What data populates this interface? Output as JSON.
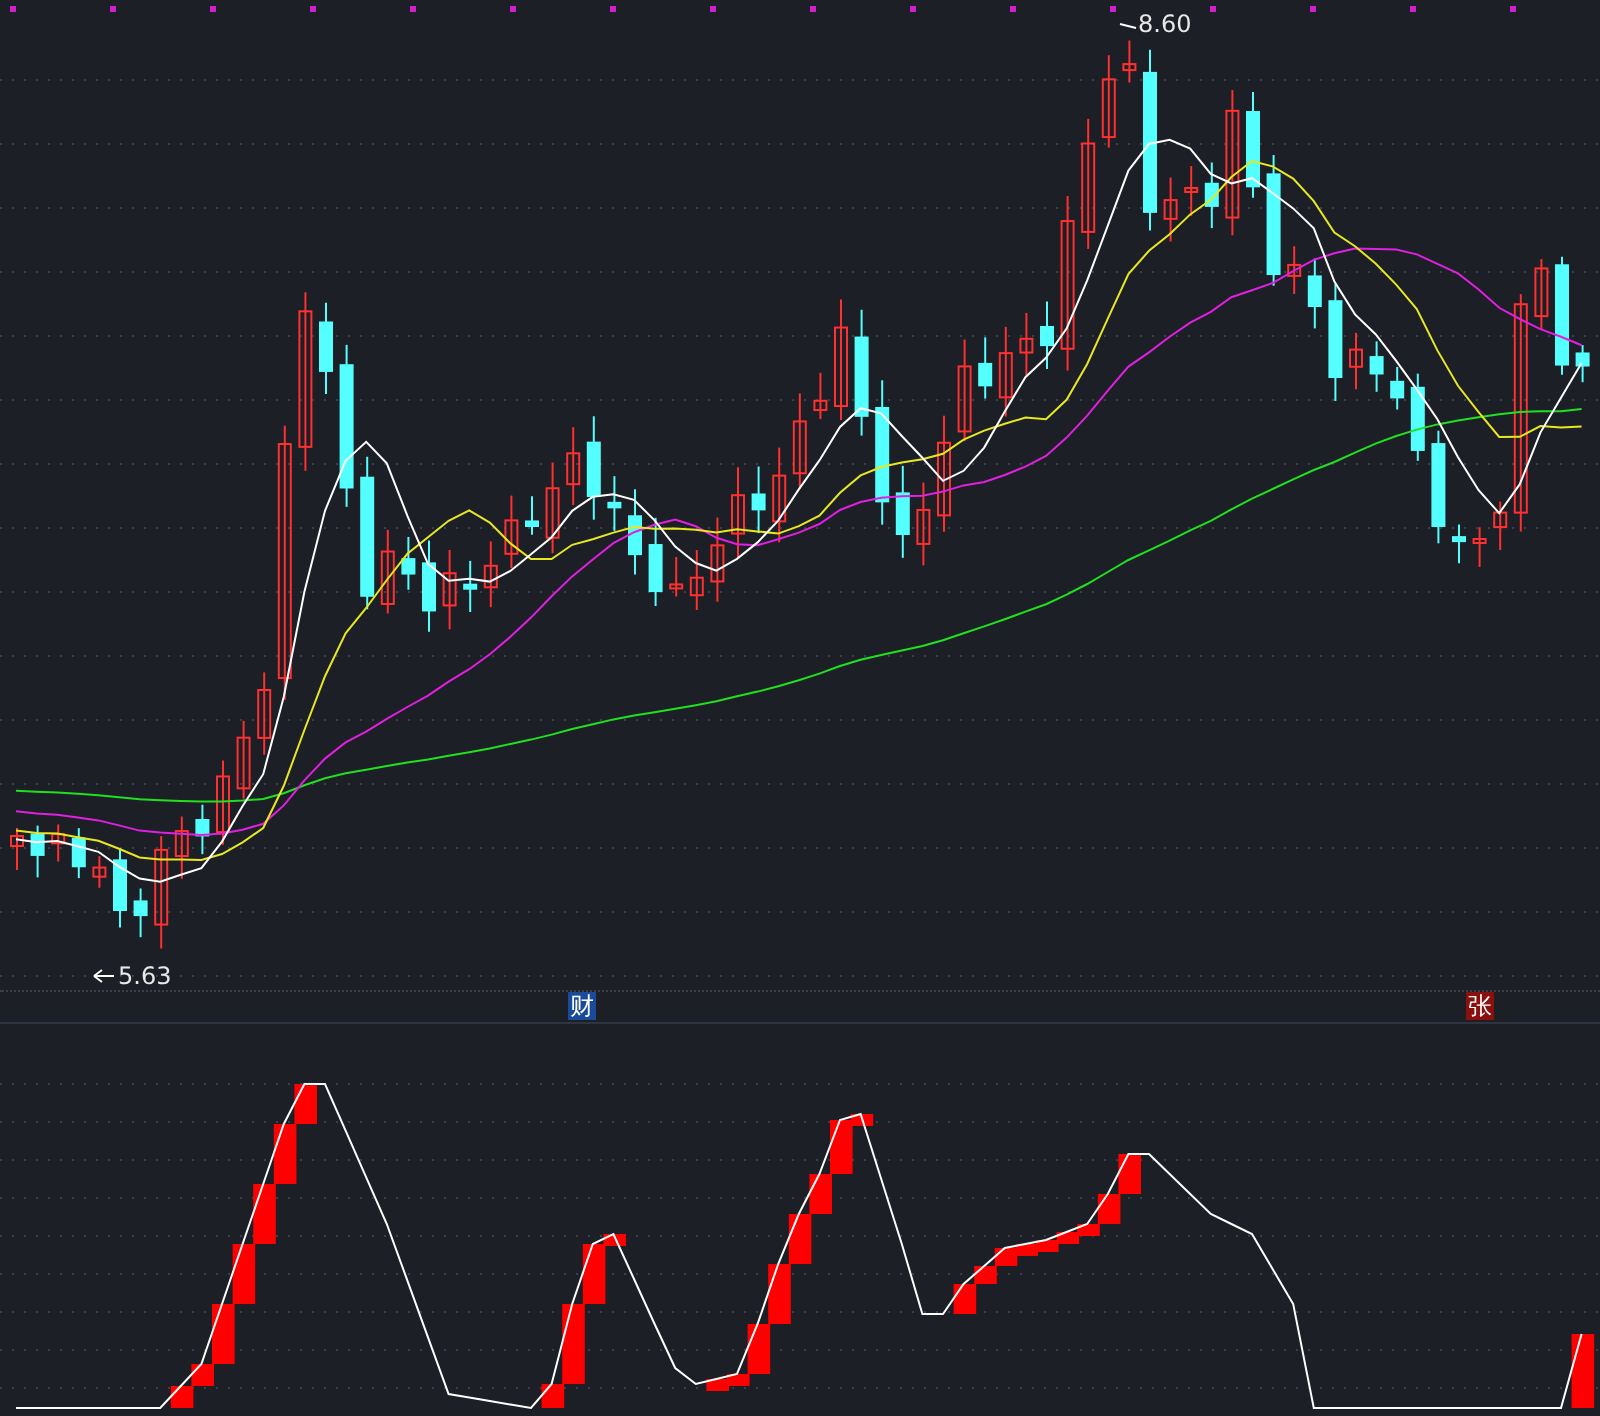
{
  "price_chart": {
    "high_label": "8.60",
    "low_label": "5.63"
  },
  "event_markers": [
    {
      "label": "财",
      "kind": "finance"
    },
    {
      "label": "张",
      "kind": "limit-up"
    }
  ]
}
